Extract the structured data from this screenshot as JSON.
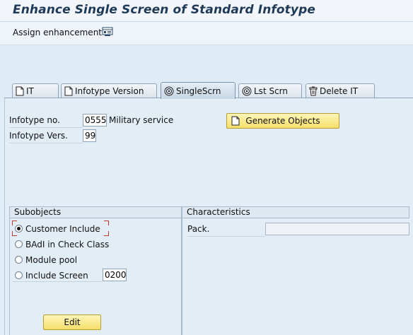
{
  "window": {
    "title": "Enhance Single Screen of Standard Infotype"
  },
  "toolbar": {
    "assign_label": "Assign enhancement",
    "assign_icon": "structure-icon"
  },
  "tabs": [
    {
      "label": "IT",
      "icon": "document-icon",
      "active": false
    },
    {
      "label": "Infotype Version",
      "icon": "document-icon",
      "active": false
    },
    {
      "label": "SingleScrn",
      "icon": "spiral-icon",
      "active": true
    },
    {
      "label": "Lst Scrn",
      "icon": "spiral-icon",
      "active": false
    },
    {
      "label": "Delete IT",
      "icon": "trash-icon",
      "active": false
    }
  ],
  "form": {
    "infotype_no_label": "Infotype no.",
    "infotype_no_value": "0555",
    "infotype_desc": "Military service",
    "infotype_vers_label": "Infotype Vers.",
    "infotype_vers_value": "99"
  },
  "generate_button": {
    "label": "Generate Objects",
    "icon": "document-icon"
  },
  "subobjects": {
    "title": "Subobjects",
    "options": [
      {
        "label": "Customer Include",
        "selected": true
      },
      {
        "label": "BAdI in Check Class",
        "selected": false
      },
      {
        "label": "Module pool",
        "selected": false
      },
      {
        "label": "Include Screen",
        "selected": false
      }
    ],
    "include_screen_value": "0200"
  },
  "characteristics": {
    "title": "Characteristics",
    "pack_label": "Pack.",
    "pack_value": ""
  },
  "edit_button": {
    "label": "Edit"
  },
  "colors": {
    "button_yellow": "#f5df6a",
    "background": "#dfebf5",
    "title_text": "#1f3a57"
  }
}
